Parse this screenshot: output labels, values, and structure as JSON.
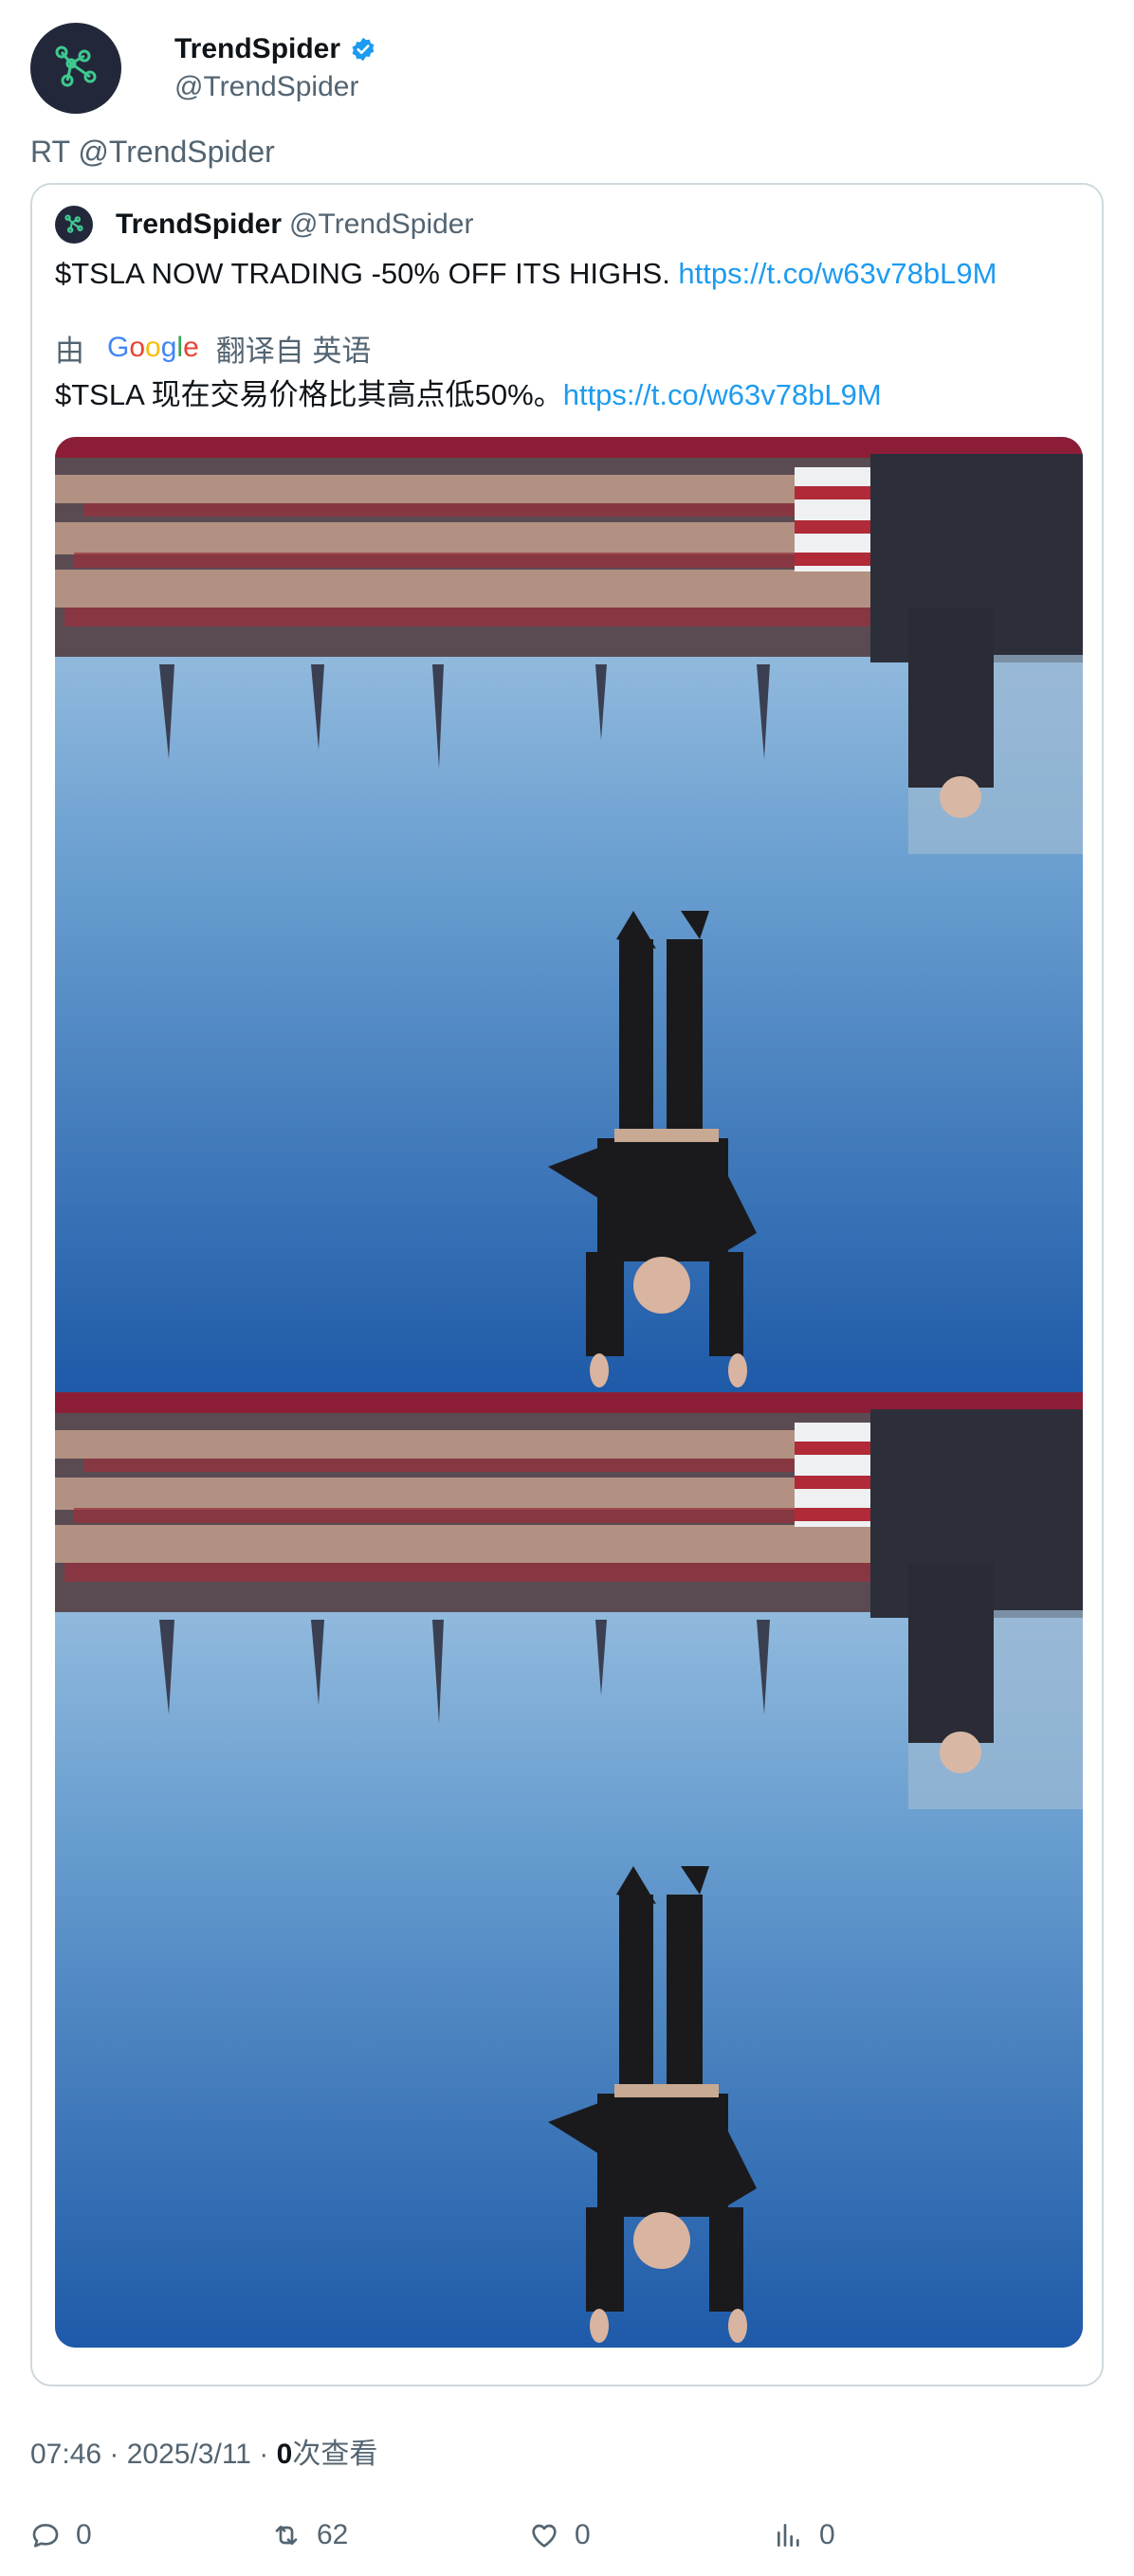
{
  "tweet": {
    "author": {
      "display_name": "TrendSpider",
      "handle": "@TrendSpider",
      "verified": true
    },
    "retweet_text": "RT @TrendSpider",
    "quote": {
      "display_name": "TrendSpider",
      "handle": "@TrendSpider",
      "text": "$TSLA NOW TRADING -50% OFF ITS HIGHS. ",
      "link": "https://t.co/w63v78bL9M",
      "translation": {
        "by_label": "由",
        "provider": "Google",
        "from_label": "翻译自 英语",
        "text": "$TSLA 现在交易价格比其高点低50%。",
        "link": "https://t.co/w63v78bL9M"
      },
      "media_count": 2
    },
    "meta": {
      "time": "07:46 · 2025/3/11 · ",
      "views_count": "0",
      "views_label": "次查看"
    },
    "actions": {
      "reply": "0",
      "retweet": "62",
      "like": "0",
      "views": "0"
    }
  },
  "colors": {
    "link": "#1d9bf0",
    "secondary": "#536471",
    "verified": "#1d9bf0",
    "border": "#cfd9de"
  },
  "icons": [
    "trendspider-logo-icon",
    "verified-badge-icon",
    "reply-icon",
    "retweet-icon",
    "like-icon",
    "views-icon"
  ]
}
